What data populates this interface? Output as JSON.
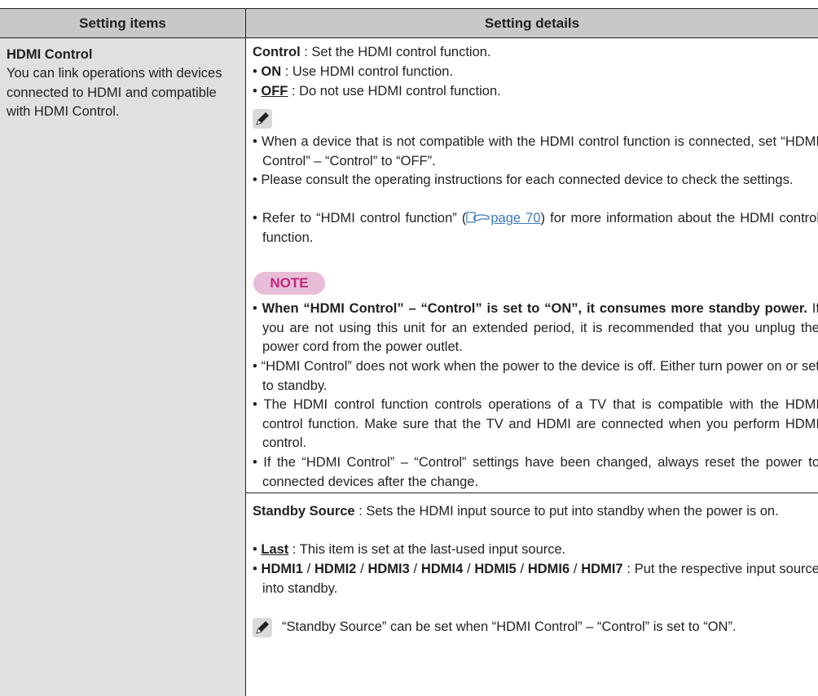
{
  "header": {
    "col1": "Setting items",
    "col2": "Setting details"
  },
  "item": {
    "title": "HDMI Control",
    "description": "You can link operations with devices connected to HDMI and compatible with HDMI Control."
  },
  "control": {
    "label": "Control",
    "desc": " : Set the HDMI control function.",
    "on_label": "ON",
    "on_desc": " : Use HDMI control function.",
    "off_label": "OFF",
    "off_desc": " : Do not use HDMI control function."
  },
  "memo": {
    "icon": "pencil-icon",
    "bullet1": "When a device that is not compatible with the HDMI control function is connected, set “HDMI Control” – “Control” to “OFF”.",
    "bullet2": "Please consult the operating instructions for each connected device to check the settings.",
    "bullet3_pre": "Refer to “HDMI control function” (",
    "bullet3_link": "page 70",
    "bullet3_post": ") for more information about the HDMI control function."
  },
  "note": {
    "badge": "NOTE",
    "bullet1_bold": "When “HDMI Control” – “Control” is set to “ON”, it consumes more standby power.",
    "bullet1_rest": " If you are not using this unit for an extended period, it is recommended that you unplug the power cord from the power outlet.",
    "bullet2": "“HDMI Control” does not work when the power to the device is off. Either turn power on or set to standby.",
    "bullet3": "The HDMI control function controls operations of a TV that is compatible with the HDMI control function. Make sure that the TV and HDMI are connected when you perform HDMI control.",
    "bullet4": "If the “HDMI Control” – “Control” settings have been changed, always reset the power to connected devices after the change."
  },
  "standby": {
    "label": "Standby Source",
    "desc": " : Sets the HDMI input source to put into standby when the power is on.",
    "last_label": "Last",
    "last_desc": " : This item is set at the last-used input source.",
    "hdmi1": "HDMI1",
    "hdmi2": "HDMI2",
    "hdmi3": "HDMI3",
    "hdmi4": "HDMI4",
    "hdmi5": "HDMI5",
    "hdmi6": "HDMI6",
    "hdmi7": "HDMI7",
    "sep": " / ",
    "hdmi_desc": " : Put the respective input source into standby.",
    "memo": "“Standby Source” can be set when “HDMI Control” – “Control” is set to “ON”."
  }
}
